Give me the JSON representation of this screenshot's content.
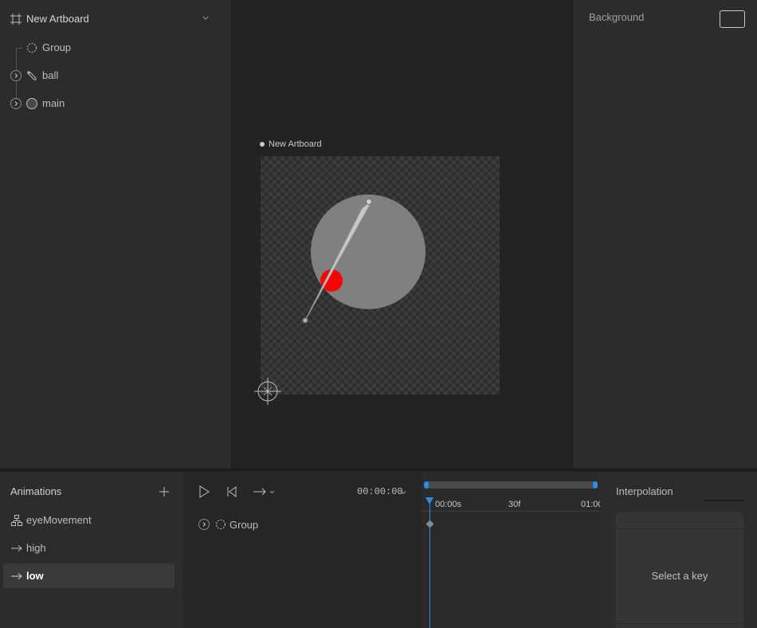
{
  "hierarchy": {
    "artboard_title": "New Artboard",
    "nodes": [
      {
        "label": "Group",
        "icon": "group-icon"
      },
      {
        "label": "ball",
        "icon": "bone-icon"
      },
      {
        "label": "main",
        "icon": "ellipse-icon"
      }
    ]
  },
  "canvas": {
    "artboard_label": "New Artboard",
    "colors": {
      "circle": "#808080",
      "ball": "#ff0000",
      "bone": "#c8c8c8"
    }
  },
  "inspector": {
    "background_label": "Background"
  },
  "animations": {
    "header": "Animations",
    "items": [
      {
        "label": "eyeMovement",
        "icon": "state-machine-icon",
        "selected": false
      },
      {
        "label": "high",
        "icon": "arrow-right-icon",
        "selected": false
      },
      {
        "label": "low",
        "icon": "arrow-right-icon",
        "selected": true
      }
    ]
  },
  "timeline": {
    "time": "00:00:00",
    "tree_group_label": "Group",
    "ticks": [
      "00:00s",
      "30f",
      "01:00"
    ],
    "accent": "#2e8bde"
  },
  "interpolation": {
    "header": "Interpolation",
    "placeholder": "Select a key"
  }
}
